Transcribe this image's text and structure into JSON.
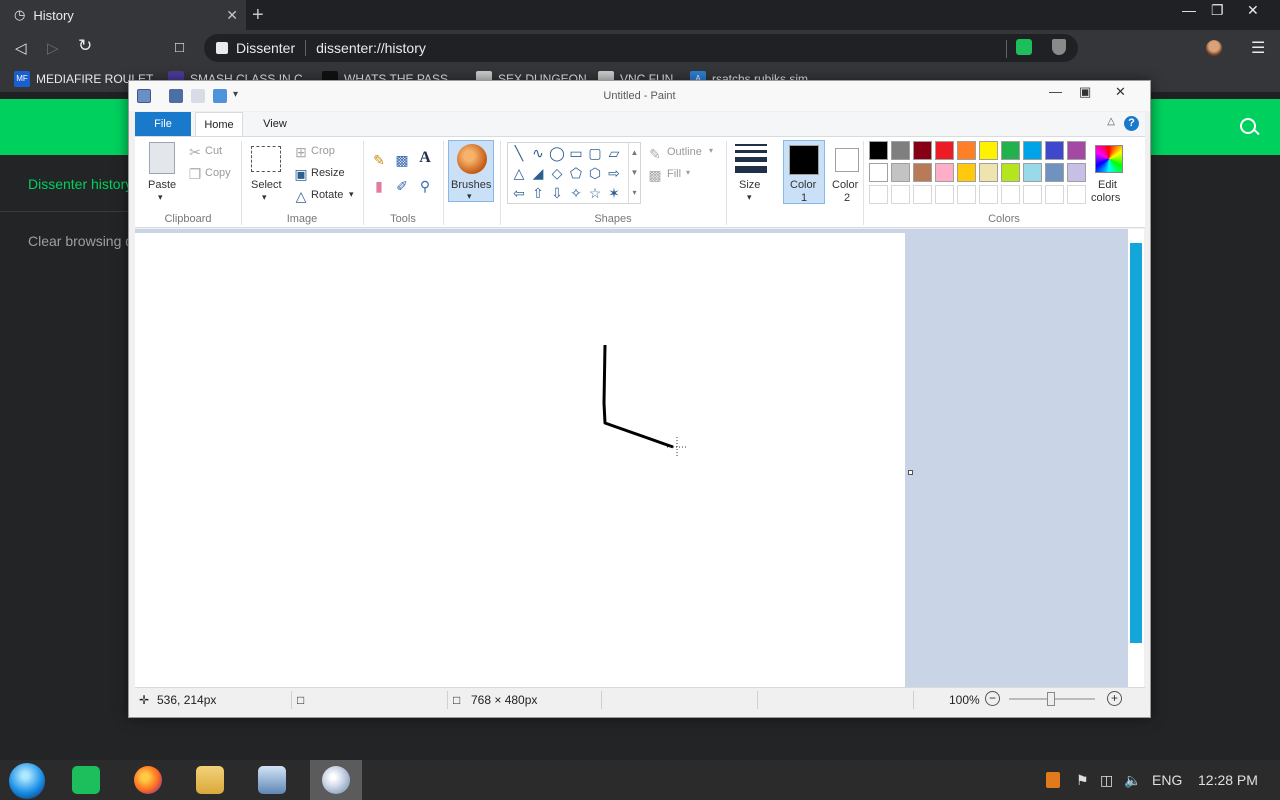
{
  "browser": {
    "tab_title": "History",
    "omnibox_site": "Dissenter",
    "omnibox_url": "dissenter://history",
    "bookmarks": [
      {
        "label": "MEDIAFIRE ROULET...",
        "icon": "mediafire-icon",
        "color": "#1a5fd0"
      },
      {
        "label": "SMASH CLASS IN C...",
        "icon": "smash-icon",
        "color": "#4b3b9a"
      },
      {
        "label": "WHATS THE PASS...",
        "icon": "whats-icon",
        "color": "#111111"
      },
      {
        "label": "SEX DUNGEON",
        "icon": "page-icon",
        "color": "#cccccc"
      },
      {
        "label": "VNC FUN",
        "icon": "page-icon",
        "color": "#cccccc"
      },
      {
        "label": "rsatchs rubiks sim...",
        "icon": "a-icon",
        "color": "#2c7fd6"
      }
    ]
  },
  "page": {
    "nav_label": "Dissenter history",
    "clear_label": "Clear browsing d"
  },
  "paint": {
    "window_title": "Untitled - Paint",
    "tabs": {
      "file": "File",
      "home": "Home",
      "view": "View"
    },
    "clipboard": {
      "paste": "Paste",
      "cut": "Cut",
      "copy": "Copy",
      "group": "Clipboard"
    },
    "image": {
      "select": "Select",
      "crop": "Crop",
      "resize": "Resize",
      "rotate": "Rotate",
      "group": "Image"
    },
    "tools": {
      "group": "Tools"
    },
    "brushes": "Brushes",
    "shapes": {
      "outline": "Outline",
      "fill": "Fill",
      "group": "Shapes"
    },
    "size": "Size",
    "color1": {
      "line1": "Color",
      "line2": "1",
      "value": "#000000"
    },
    "color2": {
      "line1": "Color",
      "line2": "2",
      "value": "#ffffff"
    },
    "edit_colors": {
      "line1": "Edit",
      "line2": "colors"
    },
    "colors_group": "Colors",
    "palette_row1": [
      "#000000",
      "#7f7f7f",
      "#880015",
      "#ed1c24",
      "#ff7f27",
      "#fff200",
      "#22b14c",
      "#00a2e8",
      "#3f48cc",
      "#a349a4"
    ],
    "palette_row2": [
      "#ffffff",
      "#c3c3c3",
      "#b97a57",
      "#ffaec9",
      "#ffc90e",
      "#efe4b0",
      "#b5e61d",
      "#99d9ea",
      "#7092be",
      "#c8bfe7"
    ],
    "status": {
      "cursor_pos": "536, 214px",
      "canvas_size": "768 × 480px",
      "zoom": "100%"
    }
  },
  "taskbar": {
    "language": "ENG",
    "time": "12:28 PM"
  }
}
